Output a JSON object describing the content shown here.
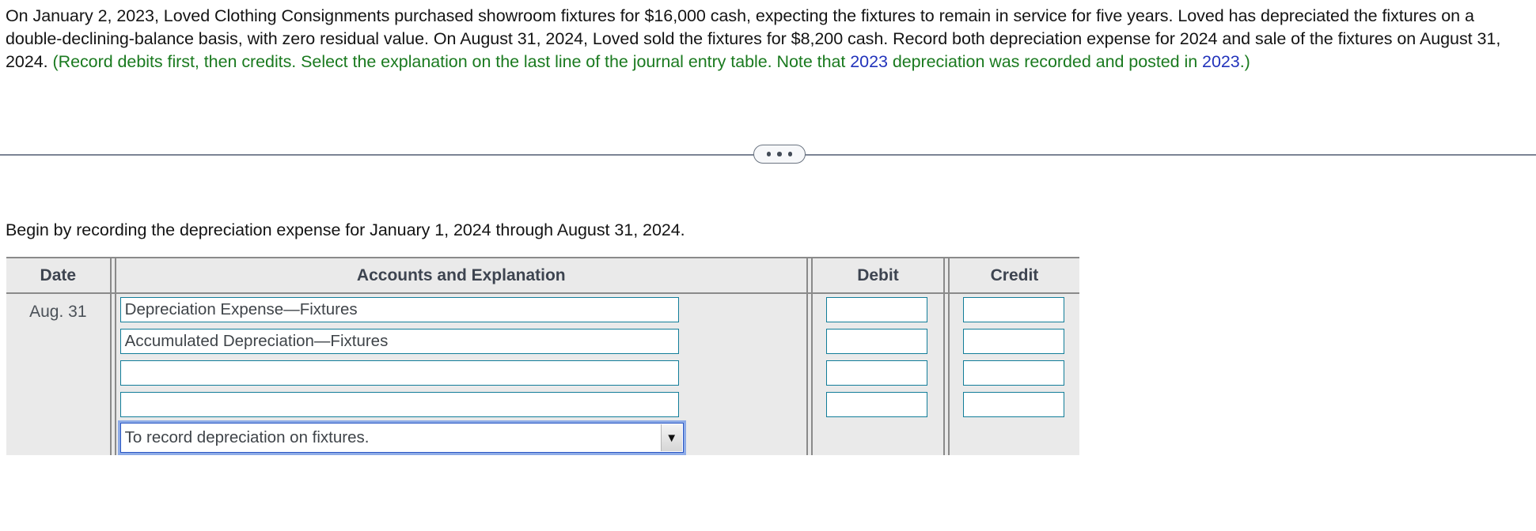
{
  "problem": {
    "part1": "On January 2, 2023, Loved Clothing Consignments purchased showroom fixtures for $16,000 cash, expecting the fixtures to remain in service for five years. Loved has depreciated the fixtures on a double-declining-balance basis, with zero residual value. On August 31, 2024, Loved sold the fixtures for $8,200 cash. Record both depreciation expense for 2024 and sale of the fixtures on August 31, 2024. ",
    "hint_a": "(Record debits first, then credits. Select the explanation on the last line of the journal entry table. Note that ",
    "hint_year_1": "2023",
    "hint_b": " depreciation was recorded and posted in ",
    "hint_year_2": "2023",
    "hint_c": ".)"
  },
  "divider": {
    "dots": [
      "dot",
      "dot",
      "dot"
    ]
  },
  "sub_prompt": "Begin by recording the depreciation expense for January 1, 2024 through August 31, 2024.",
  "journal": {
    "headers": {
      "date": "Date",
      "accounts": "Accounts and Explanation",
      "debit": "Debit",
      "credit": "Credit"
    },
    "date_value": "Aug. 31",
    "rows": [
      {
        "account": "Depreciation Expense—Fixtures",
        "debit": "",
        "credit": ""
      },
      {
        "account": "Accumulated Depreciation—Fixtures",
        "debit": "",
        "credit": ""
      },
      {
        "account": "",
        "debit": "",
        "credit": ""
      },
      {
        "account": "",
        "debit": "",
        "credit": ""
      }
    ],
    "explanation": {
      "selected": "To record depreciation on fixtures.",
      "arrow": "▼"
    }
  },
  "colors": {
    "hint_green": "#1a7a1f",
    "hint_blue": "#2233bb",
    "field_border": "#127d99",
    "focus_blue": "#2b57c4",
    "header_gray": "#eaeaea"
  }
}
